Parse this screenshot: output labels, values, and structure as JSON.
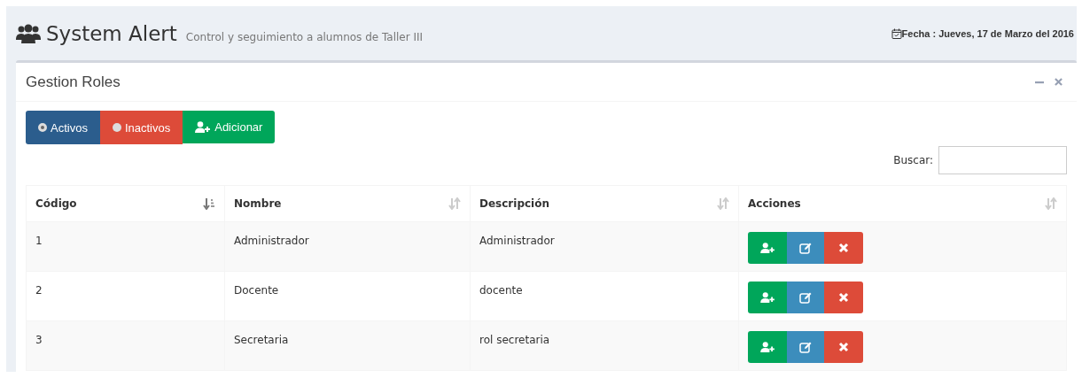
{
  "header": {
    "title": "System Alert",
    "subtitle": "Control y seguimiento a alumnos de Taller III",
    "date": "Fecha : Jueves, 17 de Marzo del 2016"
  },
  "box": {
    "title": "Gestion Roles"
  },
  "filters": [
    {
      "label": "Activos",
      "kind": "radio",
      "selected": true
    },
    {
      "label": "Inactivos",
      "kind": "radio",
      "selected": false
    },
    {
      "label": "Adicionar",
      "kind": "add"
    }
  ],
  "search": {
    "label": "Buscar:"
  },
  "table": {
    "columns": [
      {
        "label": "Código",
        "sorted": true
      },
      {
        "label": "Nombre",
        "sorted": false
      },
      {
        "label": "Descripción",
        "sorted": false
      },
      {
        "label": "Acciones",
        "sorted": false
      }
    ],
    "rows": [
      {
        "code": "1",
        "name": "Administrador",
        "description": "Administrador"
      },
      {
        "code": "2",
        "name": "Docente",
        "description": "docente"
      },
      {
        "code": "3",
        "name": "Secretaria",
        "description": "rol secretaria"
      }
    ]
  }
}
